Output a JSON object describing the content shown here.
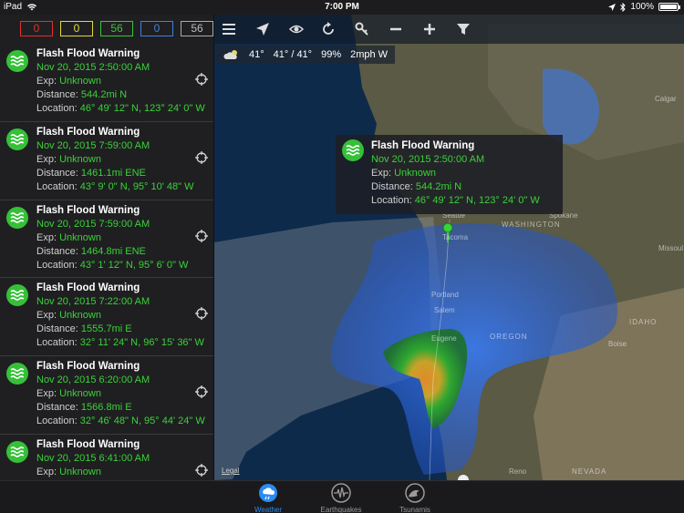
{
  "status_bar": {
    "device": "iPad",
    "time": "7:00 PM",
    "battery": "100%"
  },
  "counts": [
    {
      "value": "0",
      "color": "#e0312c"
    },
    {
      "value": "0",
      "color": "#e2d83b"
    },
    {
      "value": "56",
      "color": "#3ec43a"
    },
    {
      "value": "0",
      "color": "#3f7fe0"
    },
    {
      "value": "56",
      "color": "#aaaaaa"
    }
  ],
  "alerts": [
    {
      "title": "Flash Flood Warning",
      "date": "Nov 20, 2015  2:50:00 AM",
      "exp_label": "Exp:",
      "exp": "Unknown",
      "distance_label": "Distance:",
      "distance": "544.2mi N",
      "location_label": "Location:",
      "location": "46° 49' 12\" N, 123° 24' 0\" W"
    },
    {
      "title": "Flash Flood Warning",
      "date": "Nov 20, 2015  7:59:00 AM",
      "exp_label": "Exp:",
      "exp": "Unknown",
      "distance_label": "Distance:",
      "distance": "1461.1mi ENE",
      "location_label": "Location:",
      "location": "43° 9' 0\" N, 95° 10' 48\" W"
    },
    {
      "title": "Flash Flood Warning",
      "date": "Nov 20, 2015  7:59:00 AM",
      "exp_label": "Exp:",
      "exp": "Unknown",
      "distance_label": "Distance:",
      "distance": "1464.8mi ENE",
      "location_label": "Location:",
      "location": "43° 1' 12\" N, 95° 6' 0\" W"
    },
    {
      "title": "Flash Flood Warning",
      "date": "Nov 20, 2015  7:22:00 AM",
      "exp_label": "Exp:",
      "exp": "Unknown",
      "distance_label": "Distance:",
      "distance": "1555.7mi E",
      "location_label": "Location:",
      "location": "32° 11' 24\" N, 96° 15' 36\" W"
    },
    {
      "title": "Flash Flood Warning",
      "date": "Nov 20, 2015  6:20:00 AM",
      "exp_label": "Exp:",
      "exp": "Unknown",
      "distance_label": "Distance:",
      "distance": "1566.8mi E",
      "location_label": "Location:",
      "location": "32° 46' 48\" N, 95° 44' 24\" W"
    },
    {
      "title": "Flash Flood Warning",
      "date": "Nov 20, 2015  6:41:00 AM",
      "exp_label": "Exp:",
      "exp": "Unknown",
      "distance_label": "",
      "distance": "",
      "location_label": "",
      "location": ""
    }
  ],
  "weather_bar": {
    "temp": "41°",
    "hilo": "41° / 41°",
    "humidity": "99%",
    "wind": "2mph W"
  },
  "popup": {
    "title": "Flash Flood Warning",
    "date": "Nov 20, 2015  2:50:00 AM",
    "exp_label": "Exp:",
    "exp": "Unknown",
    "distance_label": "Distance:",
    "distance": "544.2mi N",
    "location_label": "Location:",
    "location": "46° 49' 12\" N, 123° 24' 0\" W"
  },
  "map_labels": {
    "washington": "WASHINGTON",
    "oregon": "OREGON",
    "idaho": "IDAHO",
    "nevada": "NEVADA",
    "seattle": "Seattle",
    "tacoma": "Tacoma",
    "spokane": "Spokane",
    "portland": "Portland",
    "salem": "Salem",
    "eugene": "Eugene",
    "boise": "Boise",
    "reno": "Reno",
    "calgary": "Calgar",
    "missoula": "Missoul",
    "legal": "Legal"
  },
  "tabs": [
    {
      "label": "Weather",
      "active": true
    },
    {
      "label": "Earthquakes",
      "active": false
    },
    {
      "label": "Tsunamis",
      "active": false
    }
  ]
}
